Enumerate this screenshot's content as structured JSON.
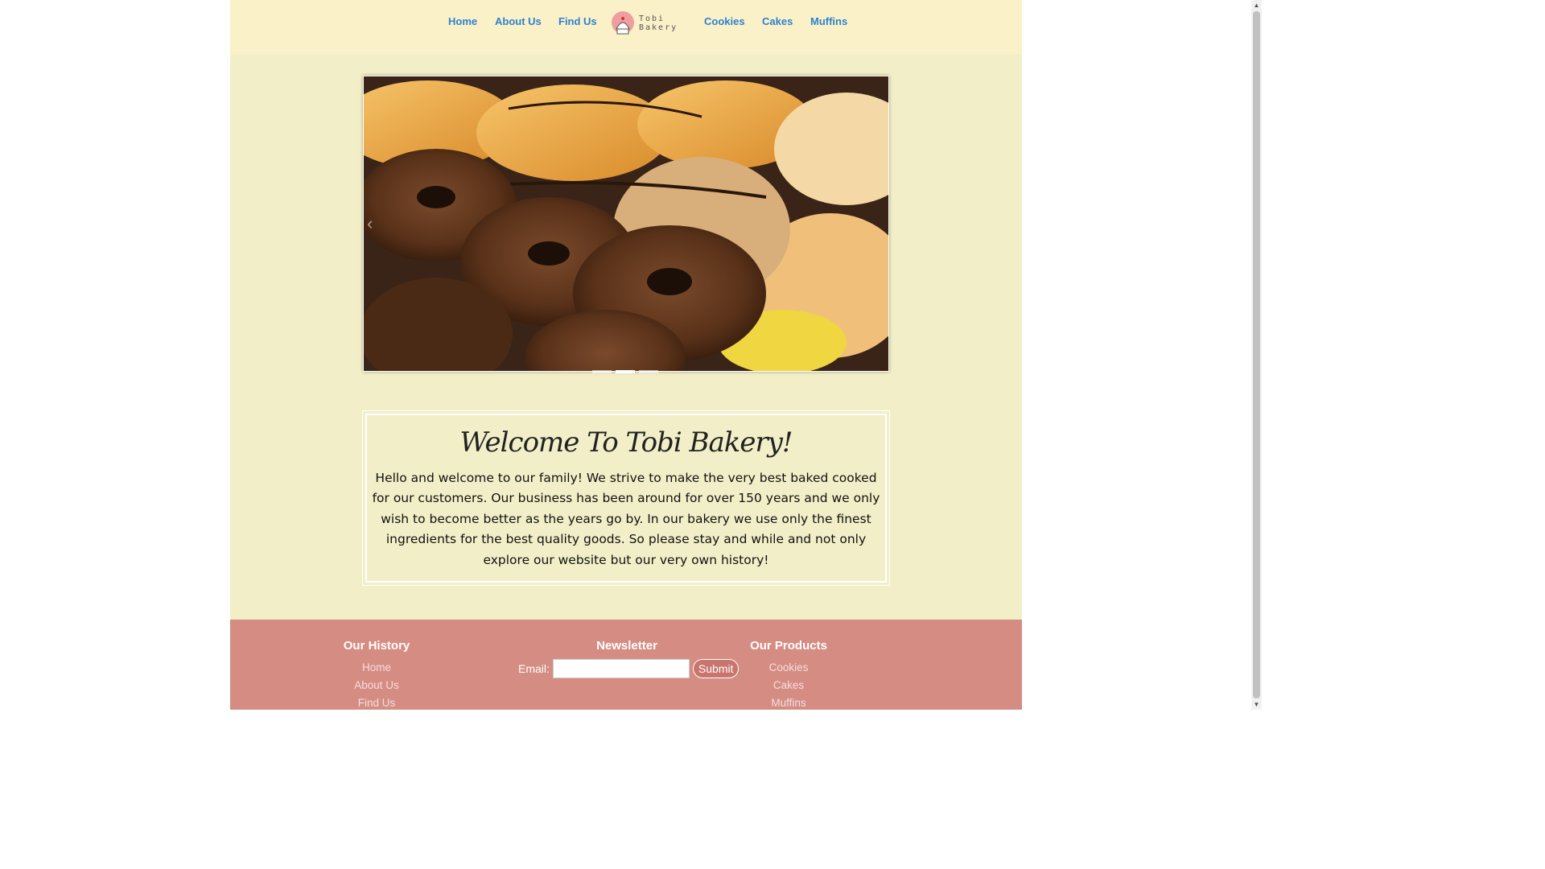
{
  "nav": {
    "left": [
      "Home",
      "About Us",
      "Find Us"
    ],
    "right": [
      "Cookies",
      "Cakes",
      "Muffins"
    ],
    "logo_line1": "Tobi",
    "logo_line2": "Bakery"
  },
  "slider": {
    "dots": 3,
    "active_dot": 1
  },
  "welcome": {
    "title": "Welcome To Tobi Bakery!",
    "text": "Hello and welcome to our family! We strive to make the very best baked cooked for our customers. Our business has been around for over 150 years and we only wish to become better as the years go by. In our bakery we use only the finest ingredients for the best quality goods. So please stay and while and not only explore our website but our very own history!"
  },
  "footer": {
    "history": {
      "title": "Our History",
      "links": [
        "Home",
        "About Us",
        "Find Us"
      ]
    },
    "newsletter": {
      "title": "Newsletter",
      "email_label": "Email:",
      "email_value": "",
      "submit_label": "Submit"
    },
    "products": {
      "title": "Our Products",
      "links": [
        "Cookies",
        "Cakes",
        "Muffins"
      ]
    }
  },
  "colors": {
    "page_bg": "#f2efc8",
    "nav_bg": "#fbf1c8",
    "nav_link": "#2b82cf",
    "footer_bg": "#d58c83"
  }
}
